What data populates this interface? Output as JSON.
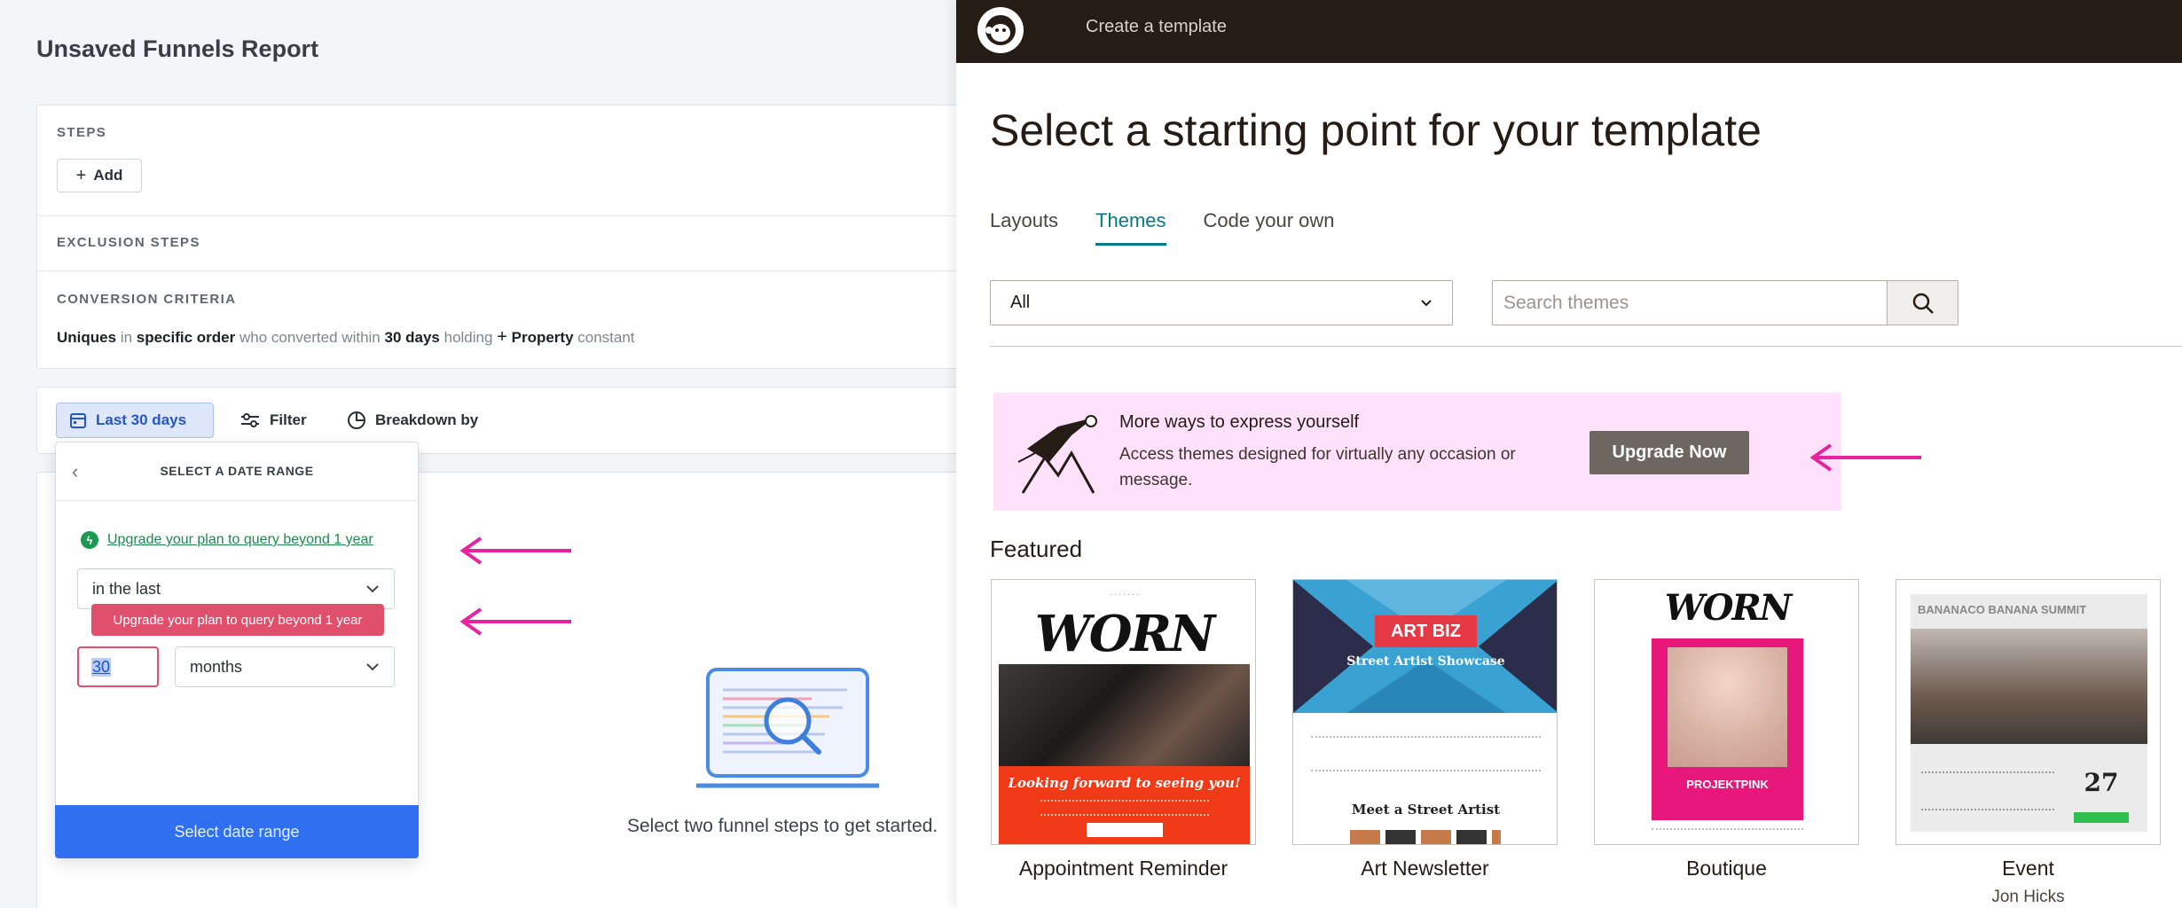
{
  "funnels": {
    "report_title": "Unsaved Funnels Report",
    "steps_label": "STEPS",
    "add_label": "Add",
    "exclusion_label": "EXCLUSION STEPS",
    "criteria_label": "CONVERSION CRITERIA",
    "criteria": {
      "uniques": "Uniques",
      "in": "in",
      "order": "specific order",
      "who": "who converted within",
      "window": "30 days",
      "holding": "holding",
      "property": "Property",
      "constant": "constant"
    },
    "toolbar": {
      "date": "Last 30 days",
      "filter": "Filter",
      "breakdown": "Breakdown by"
    },
    "empty_state": "Select two funnel steps to get started.",
    "date_dropdown": {
      "title": "SELECT A DATE RANGE",
      "upgrade_link": "Upgrade your plan to query beyond 1 year",
      "mode_value": "in the last",
      "tooltip": "Upgrade your plan to query beyond 1 year",
      "amount_value": "30",
      "unit_value": "months",
      "submit": "Select date range"
    }
  },
  "templates": {
    "topbar_title": "Create a template",
    "heading": "Select a starting point for your template",
    "tabs": [
      {
        "label": "Layouts",
        "active": false
      },
      {
        "label": "Themes",
        "active": true
      },
      {
        "label": "Code your own",
        "active": false
      }
    ],
    "filter_value": "All",
    "search_placeholder": "Search themes",
    "promo": {
      "title": "More ways to express yourself",
      "body": "Access themes designed for virtually any occasion or message.",
      "button": "Upgrade Now"
    },
    "featured_label": "Featured",
    "cards": [
      {
        "name": "Appointment Reminder",
        "author": "",
        "thumb_word": "WORN",
        "thumb_text": "Looking forward to seeing you!"
      },
      {
        "name": "Art Newsletter",
        "author": "",
        "thumb_word": "ART BIZ",
        "thumb_text": "Street Artist Showcase",
        "thumb_sub": "Meet a Street Artist"
      },
      {
        "name": "Boutique",
        "author": "",
        "thumb_word": "WORN",
        "thumb_text": "PROJEKTPINK"
      },
      {
        "name": "Event",
        "author": "Jon Hicks",
        "thumb_word": "BANANACO BANANA SUMMIT",
        "thumb_text": "27"
      }
    ]
  },
  "colors": {
    "accent_blue": "#2f6ff0",
    "annotation_magenta": "#e6249e",
    "mailchimp_teal": "#007c89",
    "promo_pink": "#ffe1fb"
  }
}
